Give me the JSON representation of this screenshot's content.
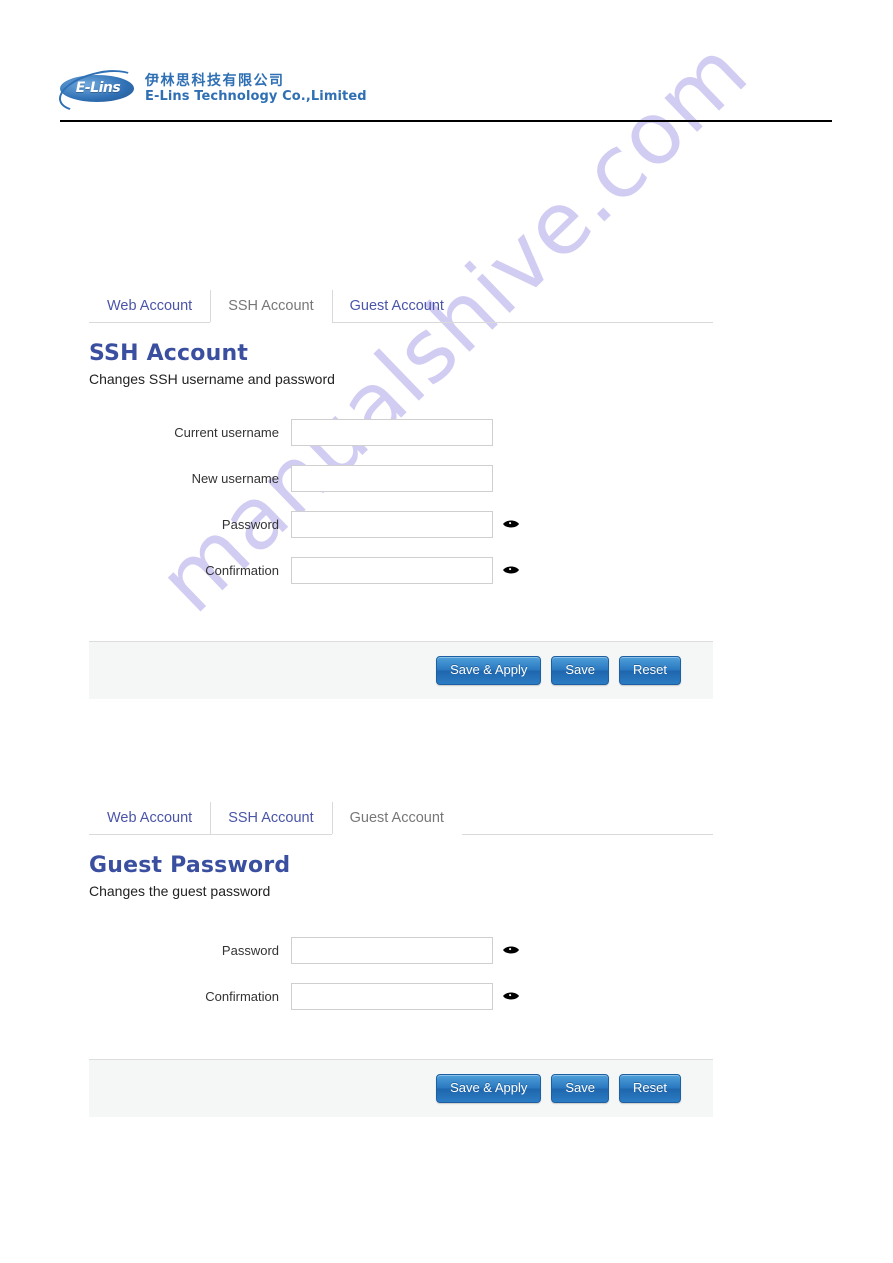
{
  "header": {
    "logo": {
      "wordmark": "E-Lins",
      "company_cn": "伊林思科技有限公司",
      "company_en": "E-Lins Technology Co.,Limited"
    }
  },
  "watermark": {
    "text": "manualshive.com",
    "color": "#c9c4ef"
  },
  "theme": {
    "heading_color": "#3a4fa0",
    "tab_link_color": "#4a55a8",
    "tab_active_color": "#777777",
    "button_color": "#2a78c0",
    "panel_border": "#d9d9d9",
    "action_bar_bg": "#f5f6f6"
  },
  "panels": [
    {
      "id": "ssh-account",
      "tabs": [
        {
          "label": "Web Account",
          "active": false
        },
        {
          "label": "SSH Account",
          "active": true
        },
        {
          "label": "Guest Account",
          "active": false
        }
      ],
      "title": "SSH Account",
      "subtitle": "Changes SSH username and password",
      "fields": [
        {
          "label": "Current username",
          "value": "",
          "placeholder": "",
          "type": "text",
          "reveal": false
        },
        {
          "label": "New username",
          "value": "",
          "placeholder": "",
          "type": "text",
          "reveal": false
        },
        {
          "label": "Password",
          "value": "",
          "placeholder": "",
          "type": "password",
          "reveal": true
        },
        {
          "label": "Confirmation",
          "value": "",
          "placeholder": "",
          "type": "password",
          "reveal": true
        }
      ],
      "buttons": [
        {
          "label": "Save & Apply"
        },
        {
          "label": "Save"
        },
        {
          "label": "Reset"
        }
      ]
    },
    {
      "id": "guest-password",
      "tabs": [
        {
          "label": "Web Account",
          "active": false
        },
        {
          "label": "SSH Account",
          "active": false
        },
        {
          "label": "Guest Account",
          "active": true
        }
      ],
      "title": "Guest Password",
      "subtitle": "Changes the guest password",
      "fields": [
        {
          "label": "Password",
          "value": "",
          "placeholder": "",
          "type": "password",
          "reveal": true
        },
        {
          "label": "Confirmation",
          "value": "",
          "placeholder": "",
          "type": "password",
          "reveal": true
        }
      ],
      "buttons": [
        {
          "label": "Save & Apply"
        },
        {
          "label": "Save"
        },
        {
          "label": "Reset"
        }
      ]
    }
  ]
}
